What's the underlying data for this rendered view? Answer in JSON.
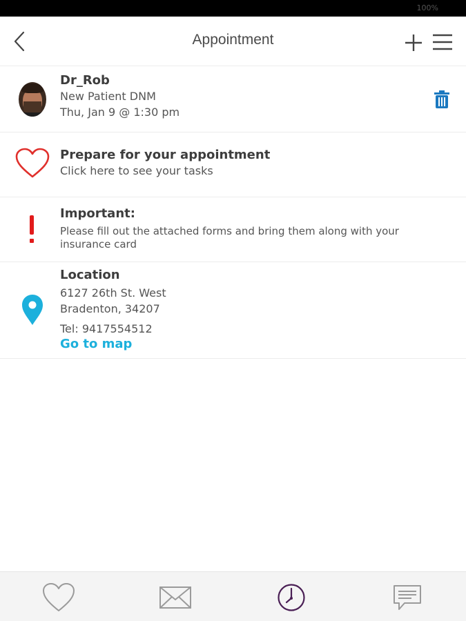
{
  "status_bar": {
    "text": "100%"
  },
  "header": {
    "title": "Appointment",
    "back_icon": "chevron-left-icon",
    "add_icon": "plus-icon",
    "menu_icon": "hamburger-menu-icon"
  },
  "appointment": {
    "doctor": "Dr_Rob",
    "visit_type": "New Patient DNM",
    "datetime": "Thu, Jan 9 @ 1:30 pm",
    "delete_icon": "trash-icon",
    "delete_color": "#1b79c0"
  },
  "prepare": {
    "title": "Prepare for your appointment",
    "subtitle": "Click here to see your tasks",
    "icon": "heart-icon",
    "icon_color": "#e0302c"
  },
  "important": {
    "title": "Important:",
    "lines": [
      "Please fill out the attached forms and bring them along with your",
      "insurance card"
    ],
    "icon": "exclamation-icon",
    "icon_color": "#e21b1b"
  },
  "location": {
    "title": "Location",
    "address_line1": "6127 26th St. West",
    "address_line2": "Bradenton, 34207",
    "phone": "Tel: 9417554512",
    "map_link": "Go to map",
    "icon": "map-pin-icon",
    "icon_color": "#1cb0dc"
  },
  "bottom_nav": {
    "items": [
      {
        "icon": "heart-outline-icon"
      },
      {
        "icon": "envelope-icon"
      },
      {
        "icon": "clock-icon",
        "active": true,
        "active_color": "#4a1f55"
      },
      {
        "icon": "chat-bubble-icon"
      }
    ]
  }
}
